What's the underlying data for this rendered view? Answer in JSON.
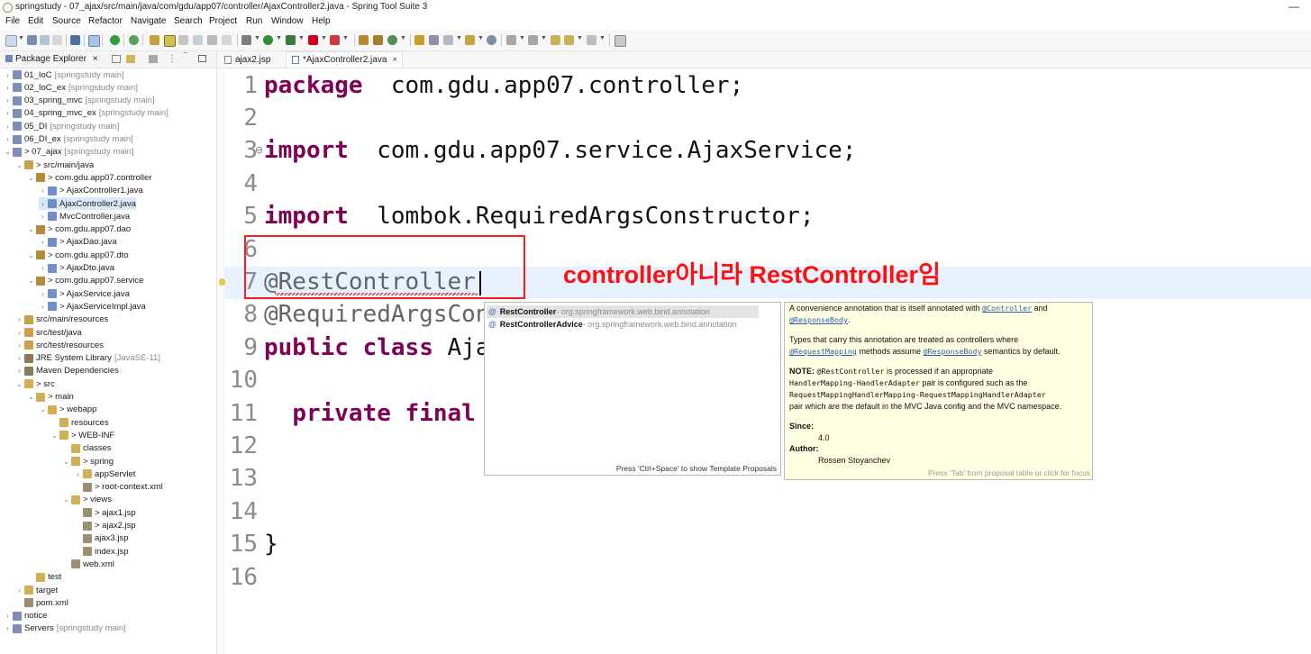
{
  "window": {
    "title": "springstudy - 07_ajax/src/main/java/com/gdu/app07/controller/AjaxController2.java - Spring Tool Suite 3",
    "minimize": "—"
  },
  "menu": [
    "File",
    "Edit",
    "Source",
    "Refactor",
    "Navigate",
    "Search",
    "Project",
    "Run",
    "Window",
    "Help"
  ],
  "explorer": {
    "tab_label": "Package Explorer",
    "rows": [
      {
        "label": "01_IoC",
        "sub": "[springstudy main]",
        "indent": 0,
        "arrow": ">",
        "color": "#7d8fb8"
      },
      {
        "label": "02_IoC_ex",
        "sub": "[springstudy main]",
        "indent": 0,
        "arrow": ">",
        "color": "#7d8fb8"
      },
      {
        "label": "03_spring_mvc",
        "sub": "[springstudy main]",
        "indent": 0,
        "arrow": ">",
        "color": "#7d8fb8"
      },
      {
        "label": "04_spring_mvc_ex",
        "sub": "[springstudy main]",
        "indent": 0,
        "arrow": ">",
        "color": "#7d8fb8"
      },
      {
        "label": "05_DI",
        "sub": "[springstudy main]",
        "indent": 0,
        "arrow": ">",
        "color": "#7d8fb8"
      },
      {
        "label": "06_DI_ex",
        "sub": "[springstudy main]",
        "indent": 0,
        "arrow": ">",
        "color": "#7d8fb8"
      },
      {
        "label": "> 07_ajax",
        "sub": "[springstudy main]",
        "indent": 0,
        "arrow": "v",
        "color": "#7d8fb8"
      },
      {
        "label": "> src/main/java",
        "sub": "",
        "indent": 1,
        "arrow": "v",
        "color": "#c9a14a"
      },
      {
        "label": "> com.gdu.app07.controller",
        "sub": "",
        "indent": 2,
        "arrow": "v",
        "color": "#b58a3c"
      },
      {
        "label": "> AjaxController1.java",
        "sub": "",
        "indent": 3,
        "arrow": ">",
        "color": "#6f8fc9"
      },
      {
        "label": "AjaxController2.java",
        "sub": "",
        "indent": 3,
        "arrow": ">",
        "color": "#6f8fc9",
        "selected": true
      },
      {
        "label": "MvcController.java",
        "sub": "",
        "indent": 3,
        "arrow": ">",
        "color": "#6f8fc9"
      },
      {
        "label": "> com.gdu.app07.dao",
        "sub": "",
        "indent": 2,
        "arrow": "v",
        "color": "#b58a3c"
      },
      {
        "label": "> AjaxDao.java",
        "sub": "",
        "indent": 3,
        "arrow": ">",
        "color": "#6f8fc9"
      },
      {
        "label": "> com.gdu.app07.dto",
        "sub": "",
        "indent": 2,
        "arrow": "v",
        "color": "#b58a3c"
      },
      {
        "label": "> AjaxDto.java",
        "sub": "",
        "indent": 3,
        "arrow": ">",
        "color": "#6f8fc9"
      },
      {
        "label": "> com.gdu.app07.service",
        "sub": "",
        "indent": 2,
        "arrow": "v",
        "color": "#b58a3c"
      },
      {
        "label": "> AjaxService.java",
        "sub": "",
        "indent": 3,
        "arrow": ">",
        "color": "#6f8fc9"
      },
      {
        "label": "> AjaxServiceImpl.java",
        "sub": "",
        "indent": 3,
        "arrow": ">",
        "color": "#6f8fc9"
      },
      {
        "label": "src/main/resources",
        "sub": "",
        "indent": 1,
        "arrow": ">",
        "color": "#c9a14a"
      },
      {
        "label": "src/test/java",
        "sub": "",
        "indent": 1,
        "arrow": ">",
        "color": "#c9a14a"
      },
      {
        "label": "src/test/resources",
        "sub": "",
        "indent": 1,
        "arrow": ">",
        "color": "#c9a14a"
      },
      {
        "label": "JRE System Library",
        "sub": "[JavaSE-11]",
        "indent": 1,
        "arrow": ">",
        "color": "#8b7a5a"
      },
      {
        "label": "Maven Dependencies",
        "sub": "",
        "indent": 1,
        "arrow": ">",
        "color": "#8b7a5a"
      },
      {
        "label": "> src",
        "sub": "",
        "indent": 1,
        "arrow": "v",
        "color": "#d1b055"
      },
      {
        "label": "> main",
        "sub": "",
        "indent": 2,
        "arrow": "v",
        "color": "#d1b055"
      },
      {
        "label": "> webapp",
        "sub": "",
        "indent": 3,
        "arrow": "v",
        "color": "#d1b055"
      },
      {
        "label": "resources",
        "sub": "",
        "indent": 4,
        "arrow": "",
        "color": "#d1b055"
      },
      {
        "label": "> WEB-INF",
        "sub": "",
        "indent": 4,
        "arrow": "v",
        "color": "#d1b055"
      },
      {
        "label": "classes",
        "sub": "",
        "indent": 5,
        "arrow": "",
        "color": "#d1b055"
      },
      {
        "label": "> spring",
        "sub": "",
        "indent": 5,
        "arrow": "v",
        "color": "#d1b055"
      },
      {
        "label": "appServlet",
        "sub": "",
        "indent": 6,
        "arrow": ">",
        "color": "#d1b055"
      },
      {
        "label": "> root-context.xml",
        "sub": "",
        "indent": 6,
        "arrow": "",
        "color": "#9a8f70"
      },
      {
        "label": "> views",
        "sub": "",
        "indent": 5,
        "arrow": "v",
        "color": "#d1b055"
      },
      {
        "label": "> ajax1.jsp",
        "sub": "",
        "indent": 6,
        "arrow": "",
        "color": "#9a8f70"
      },
      {
        "label": "> ajax2.jsp",
        "sub": "",
        "indent": 6,
        "arrow": "",
        "color": "#9a8f70"
      },
      {
        "label": "ajax3.jsp",
        "sub": "",
        "indent": 6,
        "arrow": "",
        "color": "#9a8f70"
      },
      {
        "label": "index.jsp",
        "sub": "",
        "indent": 6,
        "arrow": "",
        "color": "#9a8f70"
      },
      {
        "label": "web.xml",
        "sub": "",
        "indent": 5,
        "arrow": "",
        "color": "#9a8f70"
      },
      {
        "label": "test",
        "sub": "",
        "indent": 2,
        "arrow": "",
        "color": "#d1b055"
      },
      {
        "label": "target",
        "sub": "",
        "indent": 1,
        "arrow": ">",
        "color": "#d1b055"
      },
      {
        "label": "pom.xml",
        "sub": "",
        "indent": 1,
        "arrow": "",
        "color": "#9a8f70"
      },
      {
        "label": "notice",
        "sub": "",
        "indent": 0,
        "arrow": ">",
        "color": "#7d8fb8"
      },
      {
        "label": "Servers",
        "sub": "[springstudy main]",
        "indent": 0,
        "arrow": ">",
        "color": "#7d8fb8"
      }
    ]
  },
  "editor": {
    "tabs": [
      {
        "label": "ajax2.jsp"
      },
      {
        "label": "*AjaxController2.java",
        "active": true
      }
    ],
    "lines": [
      {
        "n": "1",
        "tokens": [
          [
            "kw",
            "package"
          ],
          [
            "",
            "  com.gdu.app07.controller;"
          ]
        ]
      },
      {
        "n": "2",
        "tokens": []
      },
      {
        "n": "3",
        "tokens": [
          [
            "kw",
            "import"
          ],
          [
            "",
            "  com.gdu.app07.service.AjaxService;"
          ]
        ]
      },
      {
        "n": "4",
        "tokens": []
      },
      {
        "n": "5",
        "tokens": [
          [
            "kw",
            "import"
          ],
          [
            "",
            "  lombok.RequiredArgsConstructor;"
          ]
        ]
      },
      {
        "n": "6",
        "tokens": []
      },
      {
        "n": "7",
        "tokens": [
          [
            "ann",
            "@RestController"
          ]
        ]
      },
      {
        "n": "8",
        "tokens": [
          [
            "ann",
            "@RequiredArgsCon"
          ]
        ]
      },
      {
        "n": "9",
        "tokens": [
          [
            "kw",
            "public"
          ],
          [
            "",
            " "
          ],
          [
            "kw",
            "class"
          ],
          [
            "",
            " Aja"
          ]
        ]
      },
      {
        "n": "10",
        "tokens": []
      },
      {
        "n": "11",
        "tokens": [
          [
            "",
            "  "
          ],
          [
            "kw",
            "private"
          ],
          [
            "",
            " "
          ],
          [
            "kw",
            "final"
          ]
        ]
      },
      {
        "n": "12",
        "tokens": []
      },
      {
        "n": "13",
        "tokens": []
      },
      {
        "n": "14",
        "tokens": []
      },
      {
        "n": "15",
        "tokens": [
          [
            "",
            "}"
          ]
        ]
      },
      {
        "n": "16",
        "tokens": []
      }
    ]
  },
  "overlay_note": "controller아니라 RestController임",
  "proposals": {
    "items": [
      {
        "name": "RestController",
        "pkg": " - org.springframework.web.bind.annotation",
        "selected": true
      },
      {
        "name": "RestControllerAdvice",
        "pkg": " - org.springframework.web.bind.annotation"
      }
    ],
    "hint": "Press 'Ctrl+Space' to show Template Proposals"
  },
  "javadoc": {
    "l1a": "A convenience annotation that is itself annotated with ",
    "l1link": "@Controller",
    "l1b": " and",
    "l2link": "@ResponseBody",
    "l2b": ".",
    "l3": "Types that carry this annotation are treated as controllers where",
    "l4link1": "@RequestMapping",
    "l4a": " methods assume ",
    "l4link2": "@ResponseBody",
    "l4b": " semantics by default.",
    "note_label": "NOTE: ",
    "note_code": "@RestController",
    "note_text": " is processed if an appropriate",
    "m1": "HandlerMapping-HandlerAdapter",
    "m1b": " pair is configured such as the",
    "m2": "RequestMappingHandlerMapping-RequestMappingHandlerAdapter",
    "m3": "pair which are the default in the MVC Java config and the MVC namespace.",
    "since_label": "Since:",
    "since_val": "4.0",
    "author_label": "Author:",
    "author_val": "Rossen Stoyanchev",
    "footer": "Press 'Tab' from proposal table or click for focus"
  }
}
